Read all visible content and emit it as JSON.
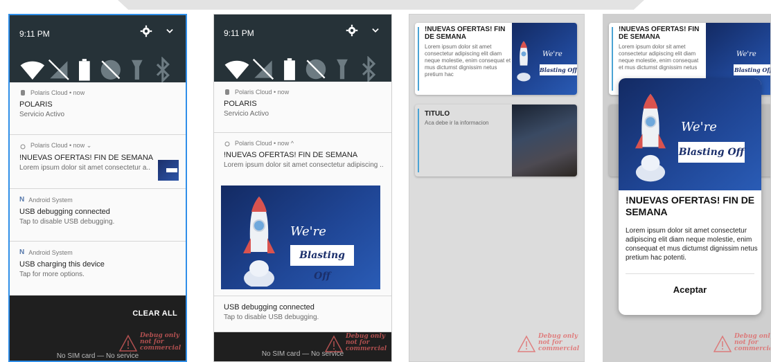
{
  "status": {
    "time": "9:11 PM"
  },
  "notifications": [
    {
      "app": "Polaris Cloud • now",
      "title": "POLARIS",
      "text": "Servicio Activo"
    },
    {
      "app": "Polaris Cloud • now ⌄",
      "title": "!NUEVAS OFERTAS! FIN DE SEMANA",
      "text": "Lorem ipsum dolor sit amet consectetur a.."
    },
    {
      "app": "Android System",
      "title": "USB debugging connected",
      "text": "Tap to disable USB debugging."
    },
    {
      "app": "Android System",
      "title": "USB charging this device",
      "text": "Tap for more options."
    }
  ],
  "expanded": {
    "app": "Polaris Cloud • now ^",
    "title": "!NUEVAS OFERTAS! FIN DE SEMANA",
    "text": "Lorem ipsum dolor sit amet consectetur adipiscing .."
  },
  "poster": {
    "line1": "We're",
    "line2": "Blasting Off"
  },
  "clear_all": "CLEAR ALL",
  "no_sim": "No SIM card — No service",
  "debug_badge": {
    "l1": "Debug only",
    "l2": "not for",
    "l3": "commercial"
  },
  "cards": {
    "offer_title": "!NUEVAS OFERTAS! FIN DE SEMANA",
    "offer_body": "Lorem ipsum dolor sit amet consectetur adipiscing elit diam neque molestie, enim consequat et mus dictumst dignissim netus pretium hac",
    "info_title": "TITULO",
    "info_body": "Aca debe ir la informacion"
  },
  "dialog": {
    "title": "!NUEVAS OFERTAS! FIN DE SEMANA",
    "body": "Lorem ipsum dolor sit amet consectetur adipiscing elit diam neque molestie, enim consequat et mus dictumst dignissim netus pretium hac potenti.",
    "button": "Aceptar"
  },
  "colors": {
    "shade": "#263238",
    "accent": "#4aa3d4",
    "poster": "#1f4594"
  }
}
